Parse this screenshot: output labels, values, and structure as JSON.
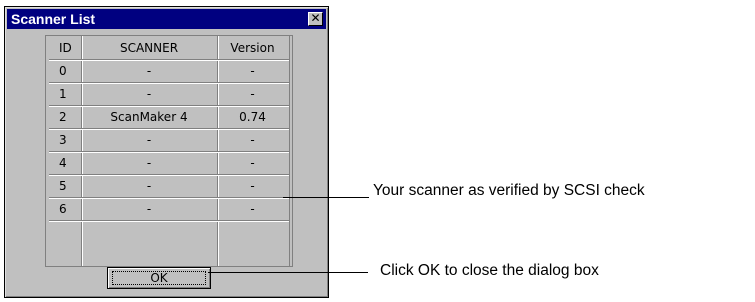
{
  "window": {
    "title": "Scanner List",
    "close_glyph": "✕"
  },
  "table": {
    "headers": [
      "ID",
      "SCANNER",
      "Version"
    ],
    "rows": [
      [
        "0",
        "-",
        "-"
      ],
      [
        "1",
        "-",
        "-"
      ],
      [
        "2",
        "ScanMaker 4",
        "0.74"
      ],
      [
        "3",
        "-",
        "-"
      ],
      [
        "4",
        "-",
        "-"
      ],
      [
        "5",
        "-",
        "-"
      ],
      [
        "6",
        "-",
        "-"
      ]
    ]
  },
  "buttons": {
    "ok_label": "OK"
  },
  "callouts": {
    "scanner": "Your scanner as verified by SCSI check",
    "ok": "Click OK to close the dialog box"
  },
  "colors": {
    "titlebar": "#000080",
    "face": "#c0c0c0"
  },
  "icons": {
    "close": "close-icon"
  }
}
